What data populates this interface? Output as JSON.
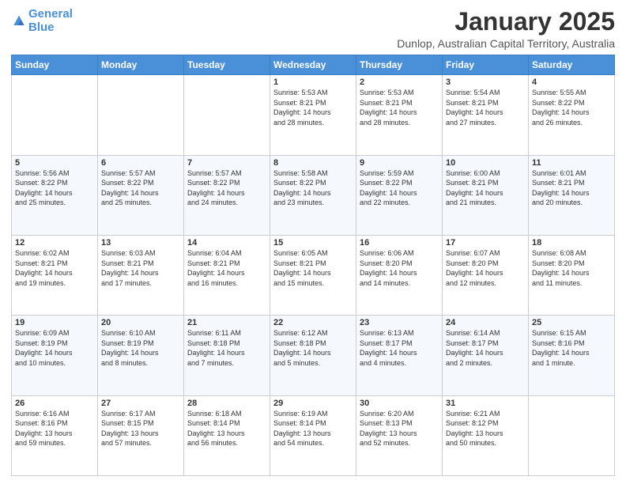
{
  "logo": {
    "line1": "General",
    "line2": "Blue"
  },
  "header": {
    "title": "January 2025",
    "subtitle": "Dunlop, Australian Capital Territory, Australia"
  },
  "weekdays": [
    "Sunday",
    "Monday",
    "Tuesday",
    "Wednesday",
    "Thursday",
    "Friday",
    "Saturday"
  ],
  "weeks": [
    [
      {
        "day": "",
        "info": ""
      },
      {
        "day": "",
        "info": ""
      },
      {
        "day": "",
        "info": ""
      },
      {
        "day": "1",
        "info": "Sunrise: 5:53 AM\nSunset: 8:21 PM\nDaylight: 14 hours\nand 28 minutes."
      },
      {
        "day": "2",
        "info": "Sunrise: 5:53 AM\nSunset: 8:21 PM\nDaylight: 14 hours\nand 28 minutes."
      },
      {
        "day": "3",
        "info": "Sunrise: 5:54 AM\nSunset: 8:21 PM\nDaylight: 14 hours\nand 27 minutes."
      },
      {
        "day": "4",
        "info": "Sunrise: 5:55 AM\nSunset: 8:22 PM\nDaylight: 14 hours\nand 26 minutes."
      }
    ],
    [
      {
        "day": "5",
        "info": "Sunrise: 5:56 AM\nSunset: 8:22 PM\nDaylight: 14 hours\nand 25 minutes."
      },
      {
        "day": "6",
        "info": "Sunrise: 5:57 AM\nSunset: 8:22 PM\nDaylight: 14 hours\nand 25 minutes."
      },
      {
        "day": "7",
        "info": "Sunrise: 5:57 AM\nSunset: 8:22 PM\nDaylight: 14 hours\nand 24 minutes."
      },
      {
        "day": "8",
        "info": "Sunrise: 5:58 AM\nSunset: 8:22 PM\nDaylight: 14 hours\nand 23 minutes."
      },
      {
        "day": "9",
        "info": "Sunrise: 5:59 AM\nSunset: 8:22 PM\nDaylight: 14 hours\nand 22 minutes."
      },
      {
        "day": "10",
        "info": "Sunrise: 6:00 AM\nSunset: 8:21 PM\nDaylight: 14 hours\nand 21 minutes."
      },
      {
        "day": "11",
        "info": "Sunrise: 6:01 AM\nSunset: 8:21 PM\nDaylight: 14 hours\nand 20 minutes."
      }
    ],
    [
      {
        "day": "12",
        "info": "Sunrise: 6:02 AM\nSunset: 8:21 PM\nDaylight: 14 hours\nand 19 minutes."
      },
      {
        "day": "13",
        "info": "Sunrise: 6:03 AM\nSunset: 8:21 PM\nDaylight: 14 hours\nand 17 minutes."
      },
      {
        "day": "14",
        "info": "Sunrise: 6:04 AM\nSunset: 8:21 PM\nDaylight: 14 hours\nand 16 minutes."
      },
      {
        "day": "15",
        "info": "Sunrise: 6:05 AM\nSunset: 8:21 PM\nDaylight: 14 hours\nand 15 minutes."
      },
      {
        "day": "16",
        "info": "Sunrise: 6:06 AM\nSunset: 8:20 PM\nDaylight: 14 hours\nand 14 minutes."
      },
      {
        "day": "17",
        "info": "Sunrise: 6:07 AM\nSunset: 8:20 PM\nDaylight: 14 hours\nand 12 minutes."
      },
      {
        "day": "18",
        "info": "Sunrise: 6:08 AM\nSunset: 8:20 PM\nDaylight: 14 hours\nand 11 minutes."
      }
    ],
    [
      {
        "day": "19",
        "info": "Sunrise: 6:09 AM\nSunset: 8:19 PM\nDaylight: 14 hours\nand 10 minutes."
      },
      {
        "day": "20",
        "info": "Sunrise: 6:10 AM\nSunset: 8:19 PM\nDaylight: 14 hours\nand 8 minutes."
      },
      {
        "day": "21",
        "info": "Sunrise: 6:11 AM\nSunset: 8:18 PM\nDaylight: 14 hours\nand 7 minutes."
      },
      {
        "day": "22",
        "info": "Sunrise: 6:12 AM\nSunset: 8:18 PM\nDaylight: 14 hours\nand 5 minutes."
      },
      {
        "day": "23",
        "info": "Sunrise: 6:13 AM\nSunset: 8:17 PM\nDaylight: 14 hours\nand 4 minutes."
      },
      {
        "day": "24",
        "info": "Sunrise: 6:14 AM\nSunset: 8:17 PM\nDaylight: 14 hours\nand 2 minutes."
      },
      {
        "day": "25",
        "info": "Sunrise: 6:15 AM\nSunset: 8:16 PM\nDaylight: 14 hours\nand 1 minute."
      }
    ],
    [
      {
        "day": "26",
        "info": "Sunrise: 6:16 AM\nSunset: 8:16 PM\nDaylight: 13 hours\nand 59 minutes."
      },
      {
        "day": "27",
        "info": "Sunrise: 6:17 AM\nSunset: 8:15 PM\nDaylight: 13 hours\nand 57 minutes."
      },
      {
        "day": "28",
        "info": "Sunrise: 6:18 AM\nSunset: 8:14 PM\nDaylight: 13 hours\nand 56 minutes."
      },
      {
        "day": "29",
        "info": "Sunrise: 6:19 AM\nSunset: 8:14 PM\nDaylight: 13 hours\nand 54 minutes."
      },
      {
        "day": "30",
        "info": "Sunrise: 6:20 AM\nSunset: 8:13 PM\nDaylight: 13 hours\nand 52 minutes."
      },
      {
        "day": "31",
        "info": "Sunrise: 6:21 AM\nSunset: 8:12 PM\nDaylight: 13 hours\nand 50 minutes."
      },
      {
        "day": "",
        "info": ""
      }
    ]
  ]
}
